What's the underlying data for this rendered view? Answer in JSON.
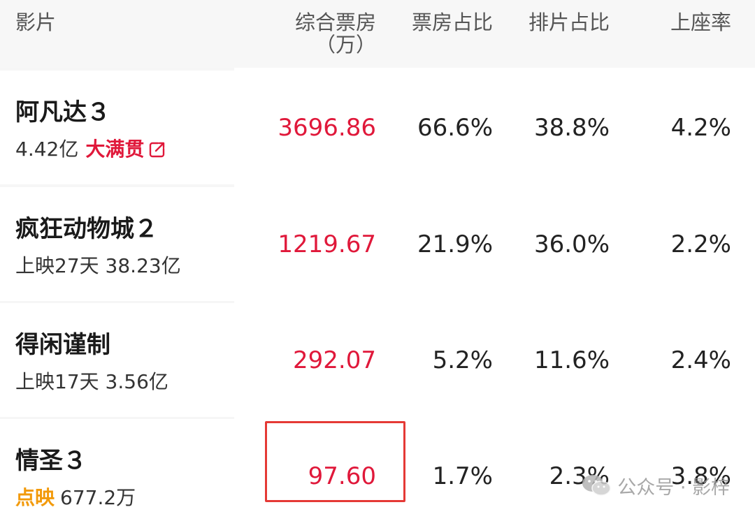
{
  "header": {
    "film": "影片",
    "box_office": "综合票房",
    "box_office_unit": "（万）",
    "box_share": "票房占比",
    "schedule_share": "排片占比",
    "seat_rate": "上座率"
  },
  "rows": [
    {
      "title": "阿凡达３",
      "total": "4.42亿",
      "tag": "大满贯",
      "tag_icon": "external-link-icon",
      "box_office": "3696.86",
      "box_share": "66.6%",
      "schedule_share": "38.8%",
      "seat_rate": "4.2%"
    },
    {
      "title": "疯狂动物城２",
      "days": "上映27天",
      "total": "38.23亿",
      "box_office": "1219.67",
      "box_share": "21.9%",
      "schedule_share": "36.0%",
      "seat_rate": "2.2%"
    },
    {
      "title": "得闲谨制",
      "days": "上映17天",
      "total": "3.56亿",
      "box_office": "292.07",
      "box_share": "5.2%",
      "schedule_share": "11.6%",
      "seat_rate": "2.4%"
    },
    {
      "title": "情圣３",
      "status": "点映",
      "total": "677.2万",
      "box_office": "97.60",
      "box_share": "1.7%",
      "schedule_share": "2.3%",
      "seat_rate": "3.8%"
    }
  ],
  "watermark": {
    "text": "公众号 · 影梓",
    "icon": "wechat-icon"
  },
  "colors": {
    "box_office_red": "#e0183a",
    "preview_orange": "#f29a0b",
    "highlight_border": "#e53935"
  }
}
